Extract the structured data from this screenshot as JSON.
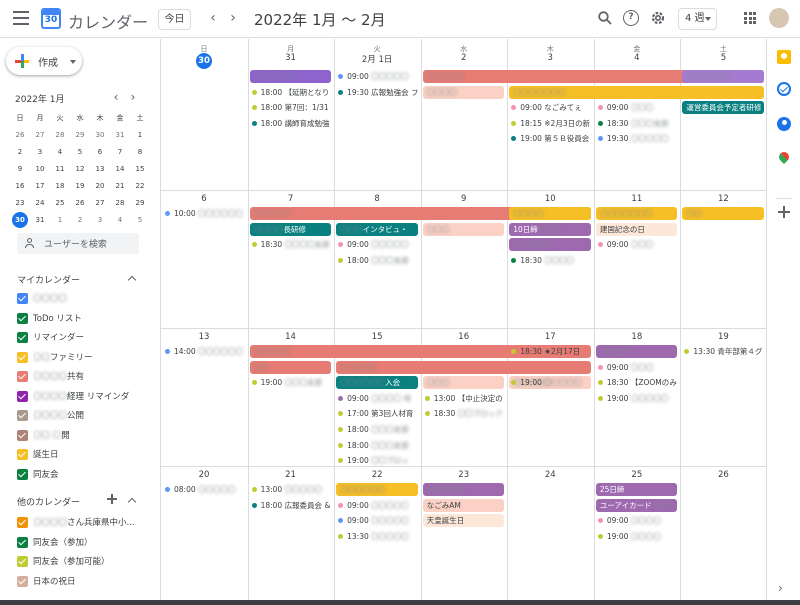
{
  "header": {
    "app_title": "カレンダー",
    "logo_day": "30",
    "today_label": "今日",
    "prev_label": "‹",
    "next_label": "›",
    "date_range": "2022年 1月 ～ 2月",
    "view_label": "4 週"
  },
  "sidebar": {
    "create_label": "作成",
    "mini_cal": {
      "title": "2022年 1月",
      "dow": [
        "日",
        "月",
        "火",
        "水",
        "木",
        "金",
        "土"
      ],
      "weeks": [
        [
          "26",
          "27",
          "28",
          "29",
          "30",
          "31",
          "1"
        ],
        [
          "2",
          "3",
          "4",
          "5",
          "6",
          "7",
          "8"
        ],
        [
          "9",
          "10",
          "11",
          "12",
          "13",
          "14",
          "15"
        ],
        [
          "16",
          "17",
          "18",
          "19",
          "20",
          "21",
          "22"
        ],
        [
          "23",
          "24",
          "25",
          "26",
          "27",
          "28",
          "29"
        ],
        [
          "30",
          "31",
          "1",
          "2",
          "3",
          "4",
          "5"
        ]
      ]
    },
    "search_users": "ユーザーを検索",
    "my_calendars_title": "マイカレンダー",
    "my_calendars": [
      {
        "label": "〇〇〇〇",
        "color": "#4285f4",
        "blur": true
      },
      {
        "label": "ToDo リスト",
        "color": "#0b8043",
        "blur": false
      },
      {
        "label": "リマインダー",
        "color": "#0b8043",
        "blur": false
      },
      {
        "label": "〇〇ファミリー",
        "color": "#f6bf26",
        "blur": true,
        "suffix": "ファミリー",
        "prefix": "〇〇"
      },
      {
        "label": "〇〇〇〇 共有",
        "color": "#e67c73",
        "blur": true,
        "suffix": "共有",
        "prefix": "〇〇〇〇"
      },
      {
        "label": "〇〇〇〇 経理 リマインダ",
        "color": "#8e24aa",
        "blur": true,
        "suffix": "経理 リマインダ",
        "prefix": "〇〇〇〇"
      },
      {
        "label": "〇〇〇〇 公開",
        "color": "#a79b8e",
        "blur": true,
        "suffix": "公開",
        "prefix": "〇〇〇〇"
      },
      {
        "label": "〇〇 〇開",
        "color": "#ad8477",
        "blur": true,
        "suffix": "開",
        "prefix": "〇〇 〇"
      },
      {
        "label": "誕生日",
        "color": "#f6bf26",
        "blur": false
      },
      {
        "label": "同友会",
        "color": "#0b8043",
        "blur": false
      }
    ],
    "other_calendars_title": "他のカレンダー",
    "other_calendars": [
      {
        "label": "〇〇〇〇さん兵庫県中小...",
        "color": "#f09300",
        "prefix": "〇〇〇〇",
        "suffix": "さん兵庫県中小..."
      },
      {
        "label": "同友会（参加）",
        "color": "#0b8043"
      },
      {
        "label": "同友会（参加可能）",
        "color": "#c0ca33"
      },
      {
        "label": "日本の祝日",
        "color": "#d6ae9e"
      }
    ]
  },
  "grid": {
    "dow": [
      "日",
      "月",
      "火",
      "水",
      "木",
      "金",
      "土"
    ],
    "weeks": [
      {
        "days": [
          "30",
          "31",
          "2月 1日",
          "2",
          "3",
          "4",
          "5"
        ]
      },
      {
        "days": [
          "6",
          "7",
          "8",
          "9",
          "10",
          "11",
          "12"
        ]
      },
      {
        "days": [
          "13",
          "14",
          "15",
          "16",
          "17",
          "18",
          "19"
        ]
      },
      {
        "days": [
          "20",
          "21",
          "22",
          "23",
          "24",
          "25",
          "26"
        ]
      }
    ]
  },
  "events": {
    "w0": [
      {
        "type": "bar",
        "col": 1,
        "span": 1,
        "row": 0,
        "color": "#8e63ce",
        "text": "〇〇〇〇〇〇",
        "blur": true
      },
      {
        "type": "bar",
        "col": 3,
        "span": 4,
        "row": 0,
        "color": "#e67c73",
        "text": "〇〇〇〇〇",
        "blur": true
      },
      {
        "type": "bar",
        "col": 6,
        "span": 1,
        "row": 0,
        "color": "#a57bd1",
        "text": "〇〇〇〇〇〇",
        "blur": true
      },
      {
        "type": "bar",
        "col": 3,
        "span": 1,
        "row": 1,
        "color": "#fad1c4",
        "text": "〇〇〇〇",
        "blur": true,
        "light": true
      },
      {
        "type": "bar",
        "col": 4,
        "span": 3,
        "row": 1,
        "color": "#f6bf26",
        "text": "〇〇〇〇〇〇〇",
        "blur": true
      },
      {
        "type": "bar",
        "col": 6,
        "span": 1,
        "row": 2,
        "color": "#0b8080",
        "text": "運営委員会予定者研修"
      },
      {
        "type": "timed",
        "col": 1,
        "row": 1,
        "dot": "#c0ca33",
        "time": "18:00",
        "text": "【延期となり"
      },
      {
        "type": "timed",
        "col": 1,
        "row": 2,
        "dot": "#c0ca33",
        "time": "18:00",
        "text": "第7回：1/31"
      },
      {
        "type": "timed",
        "col": 1,
        "row": 3,
        "dot": "#0b8080",
        "time": "18:00",
        "text": "講師育成勉強"
      },
      {
        "type": "timed",
        "col": 2,
        "row": 0,
        "dot": "#5e97f6",
        "time": "09:00",
        "text": "〇〇〇〇〇",
        "blur": true
      },
      {
        "type": "timed",
        "col": 2,
        "row": 1,
        "dot": "#0b8080",
        "time": "19:30",
        "text": "広報勉強会 フ"
      },
      {
        "type": "timed",
        "col": 4,
        "row": 2,
        "dot": "#f691b2",
        "time": "09:00",
        "text": "なごみてぇ"
      },
      {
        "type": "timed",
        "col": 4,
        "row": 3,
        "dot": "#c0ca33",
        "time": "18:15",
        "text": "※2月3日の新"
      },
      {
        "type": "timed",
        "col": 4,
        "row": 4,
        "dot": "#0b8080",
        "time": "19:00",
        "text": "第５Ｂ役員会"
      },
      {
        "type": "timed",
        "col": 5,
        "row": 2,
        "dot": "#f691b2",
        "time": "09:00",
        "text": "〇〇〇",
        "blur": true
      },
      {
        "type": "timed",
        "col": 5,
        "row": 3,
        "dot": "#0b8043",
        "time": "18:30",
        "text": "〇〇〇支部",
        "blur": true
      },
      {
        "type": "timed",
        "col": 5,
        "row": 4,
        "dot": "#5e97f6",
        "time": "19:30",
        "text": "〇〇〇〇〇",
        "blur": true
      }
    ],
    "w1": [
      {
        "type": "bar",
        "col": 1,
        "span": 4,
        "row": 0,
        "color": "#e67c73",
        "text": "〇〇〇〇〇",
        "blur": true
      },
      {
        "type": "bar",
        "col": 4,
        "span": 1,
        "row": 0,
        "color": "#f6bf26",
        "text": "〇〇〇〇",
        "blur": true
      },
      {
        "type": "bar",
        "col": 5,
        "span": 1,
        "row": 0,
        "color": "#f6bf26",
        "text": "〇〇〇〇〇〇〇",
        "blur": true
      },
      {
        "type": "bar",
        "col": 6,
        "span": 1,
        "row": 0,
        "color": "#f6bf26",
        "text": "〇〇",
        "blur": true
      },
      {
        "type": "bar",
        "col": 1,
        "span": 1,
        "row": 1,
        "color": "#0b8080",
        "text": "〇〇〇〇長研修",
        "prefix_blur": "〇〇〇〇",
        "suffix": "長研修"
      },
      {
        "type": "bar",
        "col": 2,
        "span": 1,
        "row": 1,
        "color": "#0b8080",
        "text": "〇〇〇インタビュ・",
        "prefix_blur": "〇〇〇",
        "suffix": "インタビュ・"
      },
      {
        "type": "bar",
        "col": 3,
        "span": 1,
        "row": 1,
        "color": "#fad1c4",
        "text": "〇〇〇",
        "blur": true,
        "light": true
      },
      {
        "type": "bar",
        "col": 4,
        "span": 1,
        "row": 1,
        "color": "#9e69af",
        "text": "10日締",
        "suffix_blur": "〇〇〇"
      },
      {
        "type": "bar",
        "col": 5,
        "span": 1,
        "row": 1,
        "color": "#fde7d9",
        "text": "建国記念の日",
        "light": true
      },
      {
        "type": "bar",
        "col": 4,
        "span": 1,
        "row": 2,
        "color": "#9e69af",
        "text": "〇〇〇〇〇",
        "blur": true
      },
      {
        "type": "timed",
        "col": 0,
        "row": 0,
        "dot": "#5e97f6",
        "time": "10:00",
        "text": "〇〇〇〇〇〇",
        "blur": true
      },
      {
        "type": "timed",
        "col": 1,
        "row": 2,
        "dot": "#c0ca33",
        "time": "18:30",
        "text": "〇〇〇〇支部",
        "blur": true
      },
      {
        "type": "timed",
        "col": 2,
        "row": 2,
        "dot": "#f691b2",
        "time": "09:00",
        "text": "〇〇〇〇〇",
        "blur": true
      },
      {
        "type": "timed",
        "col": 2,
        "row": 3,
        "dot": "#c0ca33",
        "time": "18:00",
        "text": "〇〇〇支部",
        "blur": true,
        "visible_suffix": "支部"
      },
      {
        "type": "timed",
        "col": 4,
        "row": 3,
        "dot": "#0b8043",
        "time": "18:30",
        "text": "〇〇〇〇",
        "blur": true
      },
      {
        "type": "timed",
        "col": 5,
        "row": 2,
        "dot": "#f691b2",
        "time": "09:00",
        "text": "〇〇〇",
        "blur": true
      }
    ],
    "w2": [
      {
        "type": "bar",
        "col": 1,
        "span": 4,
        "row": 0,
        "color": "#e67c73",
        "text": "〇〇〇〇〇",
        "blur": true
      },
      {
        "type": "bar",
        "col": 1,
        "span": 1,
        "row": 1,
        "color": "#e67c73",
        "text": "〇〇",
        "blur": true
      },
      {
        "type": "bar",
        "col": 2,
        "span": 3,
        "row": 1,
        "color": "#e67c73",
        "text": "〇〇〇〇〇",
        "blur": true
      },
      {
        "type": "bar",
        "col": 2,
        "span": 1,
        "row": 2,
        "color": "#0b8080",
        "text": "〇〇〇〇〇〇入会",
        "prefix_blur": "〇〇〇〇〇〇",
        "suffix": "入会"
      },
      {
        "type": "bar",
        "col": 3,
        "span": 1,
        "row": 2,
        "color": "#fad1c4",
        "text": "〇〇〇",
        "blur": true,
        "light": true
      },
      {
        "type": "bar",
        "col": 5,
        "span": 1,
        "row": 0,
        "color": "#9e69af",
        "text": "〇〇〇〇",
        "blur": true
      },
      {
        "type": "bar",
        "col": 4,
        "span": 1,
        "row": 2,
        "color": "#fad1c4",
        "text": "〇〇〇〇〇",
        "blur": true,
        "light": true
      },
      {
        "type": "timed",
        "col": 0,
        "row": 0,
        "dot": "#5e97f6",
        "time": "14:00",
        "text": "〇〇〇〇〇〇",
        "blur": true
      },
      {
        "type": "timed",
        "col": 1,
        "row": 2,
        "dot": "#c0ca33",
        "time": "19:00",
        "text": "〇〇〇支部",
        "blur": true,
        "visible_suffix": "支部"
      },
      {
        "type": "timed",
        "col": 4,
        "row": 0,
        "dot": "#c0ca33",
        "time": "18:30",
        "text": "★2月17日"
      },
      {
        "type": "timed",
        "col": 4,
        "row": 2,
        "dot": "#c0ca33",
        "time": "19:00",
        "text": "〇〇〇〇〇",
        "blur": true
      },
      {
        "type": "timed",
        "col": 5,
        "row": 1,
        "dot": "#f691b2",
        "time": "09:00",
        "text": "〇〇〇",
        "blur": true
      },
      {
        "type": "timed",
        "col": 5,
        "row": 2,
        "dot": "#c0ca33",
        "time": "18:30",
        "text": "【ZOOMのみ"
      },
      {
        "type": "timed",
        "col": 5,
        "row": 3,
        "dot": "#c0ca33",
        "time": "19:00",
        "text": "〇〇〇〇〇",
        "blur": true
      },
      {
        "type": "timed",
        "col": 6,
        "row": 0,
        "dot": "#c0ca33",
        "time": "13:30",
        "text": "青年部第４グ"
      },
      {
        "type": "timed",
        "col": 2,
        "row": 3,
        "dot": "#9e69af",
        "time": "09:00",
        "text": "〇〇〇〇 IB",
        "blur": true
      },
      {
        "type": "timed",
        "col": 2,
        "row": 4,
        "dot": "#c0ca33",
        "time": "17:00",
        "text": "第3回人材育"
      },
      {
        "type": "timed",
        "col": 2,
        "row": 5,
        "dot": "#c0ca33",
        "time": "18:00",
        "text": "〇〇〇支部",
        "blur": true
      },
      {
        "type": "timed",
        "col": 2,
        "row": 6,
        "dot": "#c0ca33",
        "time": "18:00",
        "text": "〇〇〇支部",
        "blur": true
      },
      {
        "type": "timed",
        "col": 2,
        "row": 7,
        "dot": "#c0ca33",
        "time": "19:00",
        "text": "〇〇ブロッ",
        "blur": true
      },
      {
        "type": "timed",
        "col": 3,
        "row": 3,
        "dot": "#c0ca33",
        "time": "13:00",
        "text": "【中止決定の"
      },
      {
        "type": "timed",
        "col": 3,
        "row": 4,
        "dot": "#c0ca33",
        "time": "18:30",
        "text": "〇〇ブロック",
        "blur": true
      }
    ],
    "w3": [
      {
        "type": "bar",
        "col": 2,
        "span": 1,
        "row": 0,
        "color": "#f6bf26",
        "text": "〇〇〇〇〇〇",
        "blur": true
      },
      {
        "type": "bar",
        "col": 3,
        "span": 1,
        "row": 0,
        "color": "#9e69af",
        "text": "〇〇〇〇〇",
        "blur": true
      },
      {
        "type": "bar",
        "col": 3,
        "span": 1,
        "row": 1,
        "color": "#fad1c4",
        "text": "なごみAM",
        "light": true
      },
      {
        "type": "bar",
        "col": 3,
        "span": 1,
        "row": 2,
        "color": "#fde7d9",
        "text": "天皇誕生日",
        "light": true
      },
      {
        "type": "bar",
        "col": 5,
        "span": 1,
        "row": 0,
        "color": "#9e69af",
        "text": "25日締"
      },
      {
        "type": "bar",
        "col": 5,
        "span": 1,
        "row": 1,
        "color": "#9e69af",
        "text": "ユーアイカード 〇〇",
        "suffix_blur": "〇〇"
      },
      {
        "type": "timed",
        "col": 0,
        "row": 0,
        "dot": "#5e97f6",
        "time": "08:00",
        "text": "〇〇〇〇〇",
        "blur": true
      },
      {
        "type": "timed",
        "col": 1,
        "row": 0,
        "dot": "#c0ca33",
        "time": "13:00",
        "text": "〇〇〇〇〇",
        "blur": true
      },
      {
        "type": "timed",
        "col": 1,
        "row": 1,
        "dot": "#0b8080",
        "time": "18:00",
        "text": "広報委員会 &"
      },
      {
        "type": "timed",
        "col": 2,
        "row": 1,
        "dot": "#f691b2",
        "time": "09:00",
        "text": "〇〇〇〇〇",
        "blur": true
      },
      {
        "type": "timed",
        "col": 2,
        "row": 2,
        "dot": "#5e97f6",
        "time": "09:00",
        "text": "〇〇〇〇〇",
        "blur": true
      },
      {
        "type": "timed",
        "col": 2,
        "row": 3,
        "dot": "#c0ca33",
        "time": "13:30",
        "text": "〇〇〇〇〇",
        "blur": true
      },
      {
        "type": "timed",
        "col": 5,
        "row": 2,
        "dot": "#f691b2",
        "time": "09:00",
        "text": "〇〇〇〇",
        "blur": true
      },
      {
        "type": "timed",
        "col": 5,
        "row": 3,
        "dot": "#c0ca33",
        "time": "19:00",
        "text": "〇〇〇〇",
        "blur": true
      }
    ]
  }
}
